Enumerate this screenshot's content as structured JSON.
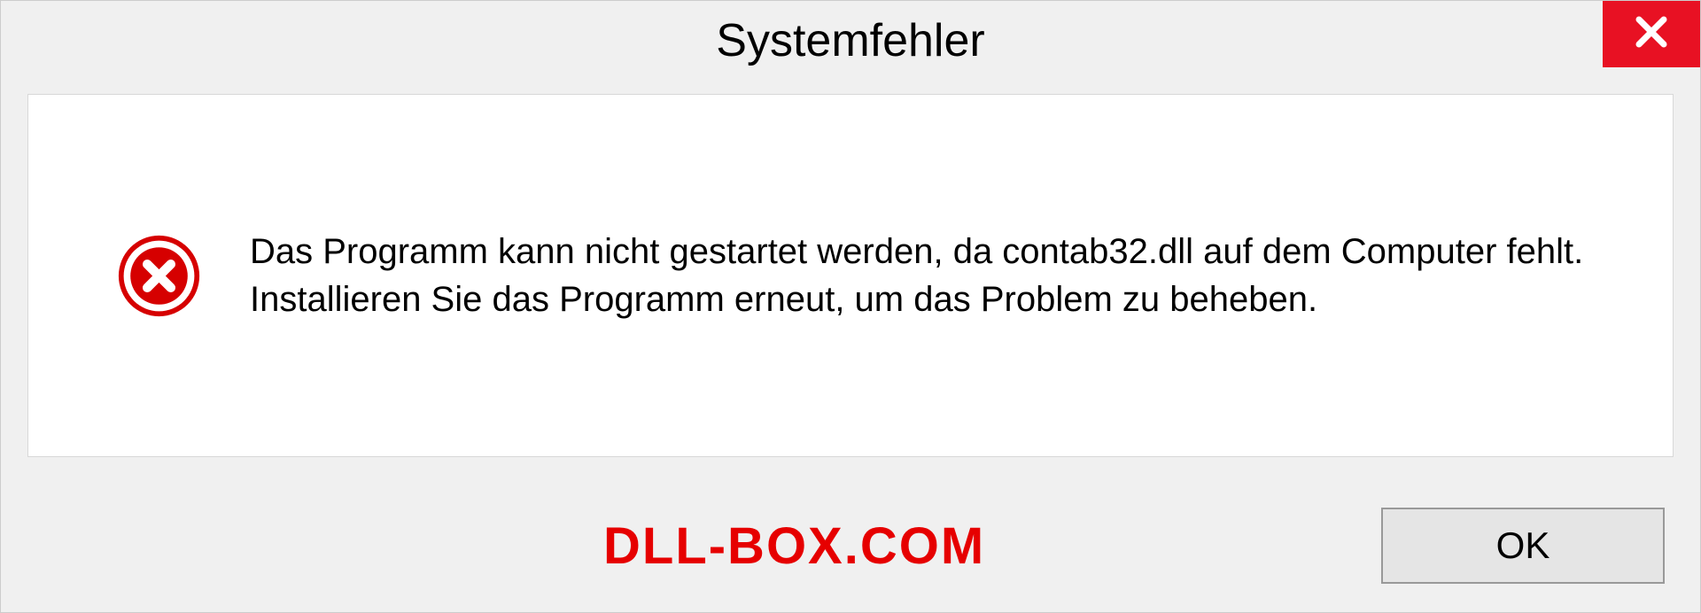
{
  "dialog": {
    "title": "Systemfehler",
    "message": "Das Programm kann nicht gestartet werden, da contab32.dll auf dem Computer fehlt. Installieren Sie das Programm erneut, um das Problem zu beheben.",
    "ok_label": "OK"
  },
  "watermark": "DLL-BOX.COM",
  "colors": {
    "close_bg": "#e81123",
    "error_icon": "#d60000",
    "watermark": "#e60000"
  }
}
